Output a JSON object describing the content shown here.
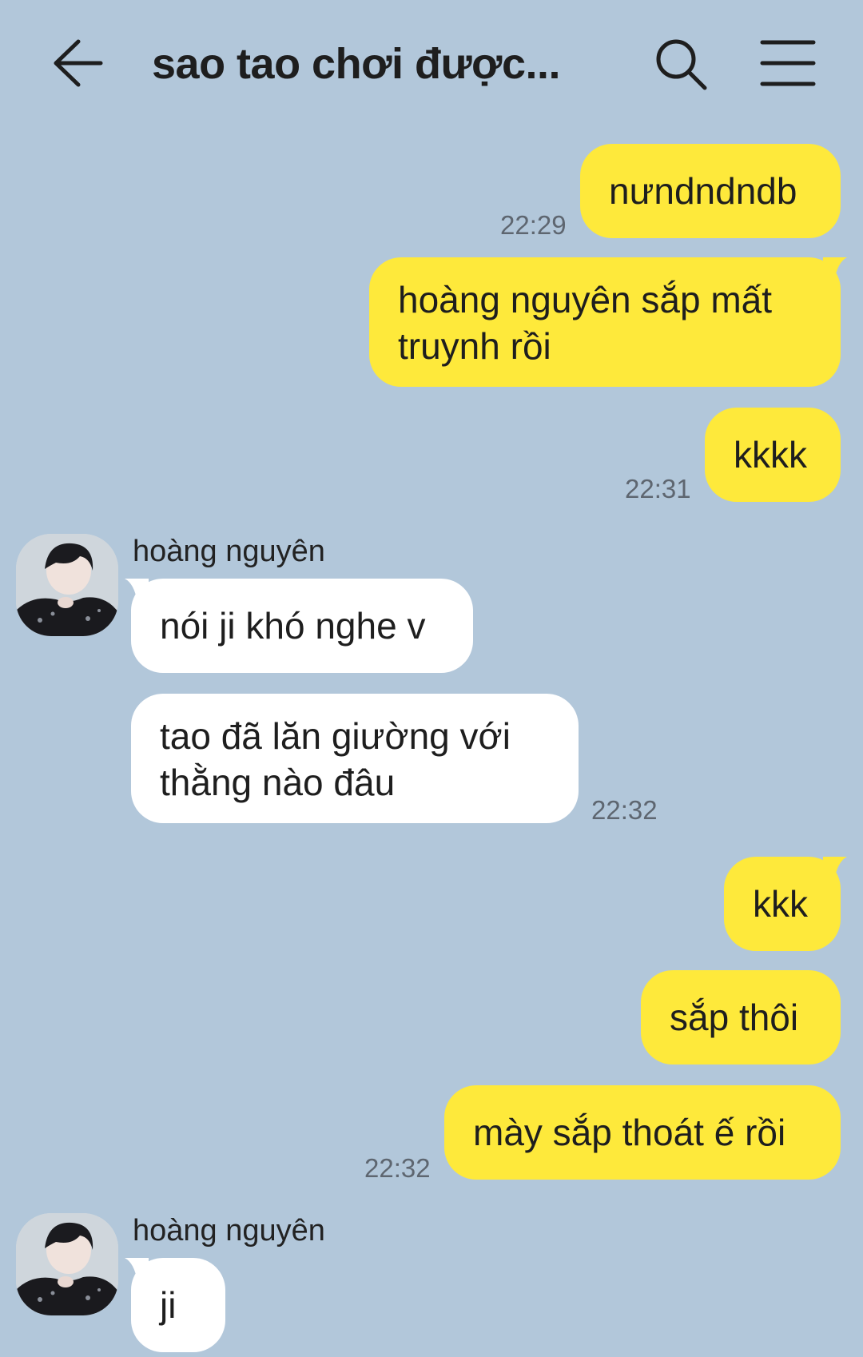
{
  "header": {
    "title": "sao tao chơi được...",
    "back_icon": "arrow-left-icon",
    "search_icon": "search-icon",
    "menu_icon": "hamburger-menu-icon"
  },
  "colors": {
    "background": "#b2c7da",
    "my_bubble": "#fee93b",
    "their_bubble": "#ffffff"
  },
  "messages": [
    {
      "from": "me",
      "text": "nưndndndb",
      "time": "22:29"
    },
    {
      "from": "me",
      "text": "hoàng nguyên sắp mất truynh rồi"
    },
    {
      "from": "me",
      "text": "kkkk",
      "time": "22:31"
    },
    {
      "from": "them",
      "sender": "hoàng nguyên",
      "text": "nói ji khó nghe v"
    },
    {
      "from": "them",
      "text": "tao đã lăn giường với thằng nào đâu",
      "time": "22:32"
    },
    {
      "from": "me",
      "text": "kkk"
    },
    {
      "from": "me",
      "text": "sắp thôi"
    },
    {
      "from": "me",
      "text": "mày sắp thoát ế rồi",
      "time": "22:32"
    },
    {
      "from": "them",
      "sender": "hoàng nguyên",
      "text": "ji"
    }
  ],
  "lines": {
    "m1_l1": "hoàng nguyên sắp mất",
    "m1_l2": "truynh rồi",
    "m4_l1": "tao đã lăn giường với",
    "m4_l2": "thằng nào đâu"
  }
}
